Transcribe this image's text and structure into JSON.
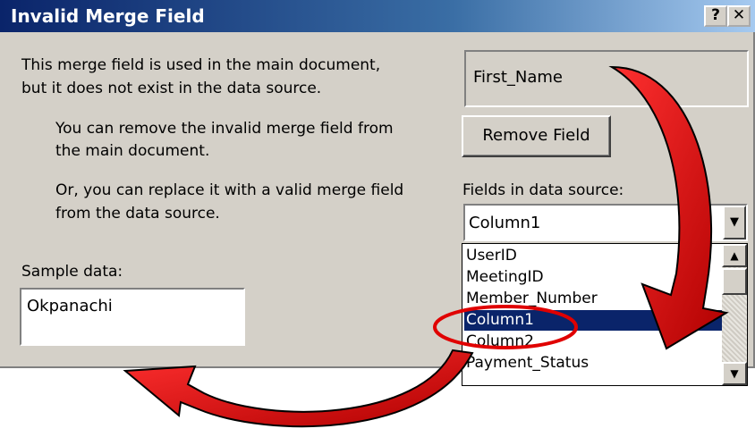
{
  "dialog": {
    "title": "Invalid Merge Field",
    "help_button": "?",
    "close_button": "✕",
    "message_line1": "This merge field is used in the main document,",
    "message_line2": "but it does not exist in the data source.",
    "remove_line1": "You can remove the invalid merge field from",
    "remove_line2": "the main document.",
    "replace_line1": "Or, you can replace it with a valid merge field",
    "replace_line2": "from the data source.",
    "invalid_field": "First_Name",
    "remove_button": "Remove Field",
    "fields_label": "Fields in data source:",
    "fields_selected": "Column1",
    "field_options": [
      "UserID",
      "MeetingID",
      "Member_Number",
      "Column1",
      "Column2",
      "Payment_Status"
    ],
    "sample_label": "Sample data:",
    "sample_value": "Okpanachi"
  },
  "colors": {
    "titlebar": "#0a246a",
    "dialog_face": "#d4d0c8",
    "highlight": "#0a246a",
    "annotation_arrow": "#e00000"
  },
  "icons": [
    "help-icon",
    "close-icon",
    "dropdown-arrow-icon",
    "scroll-up-icon",
    "scroll-down-icon"
  ]
}
